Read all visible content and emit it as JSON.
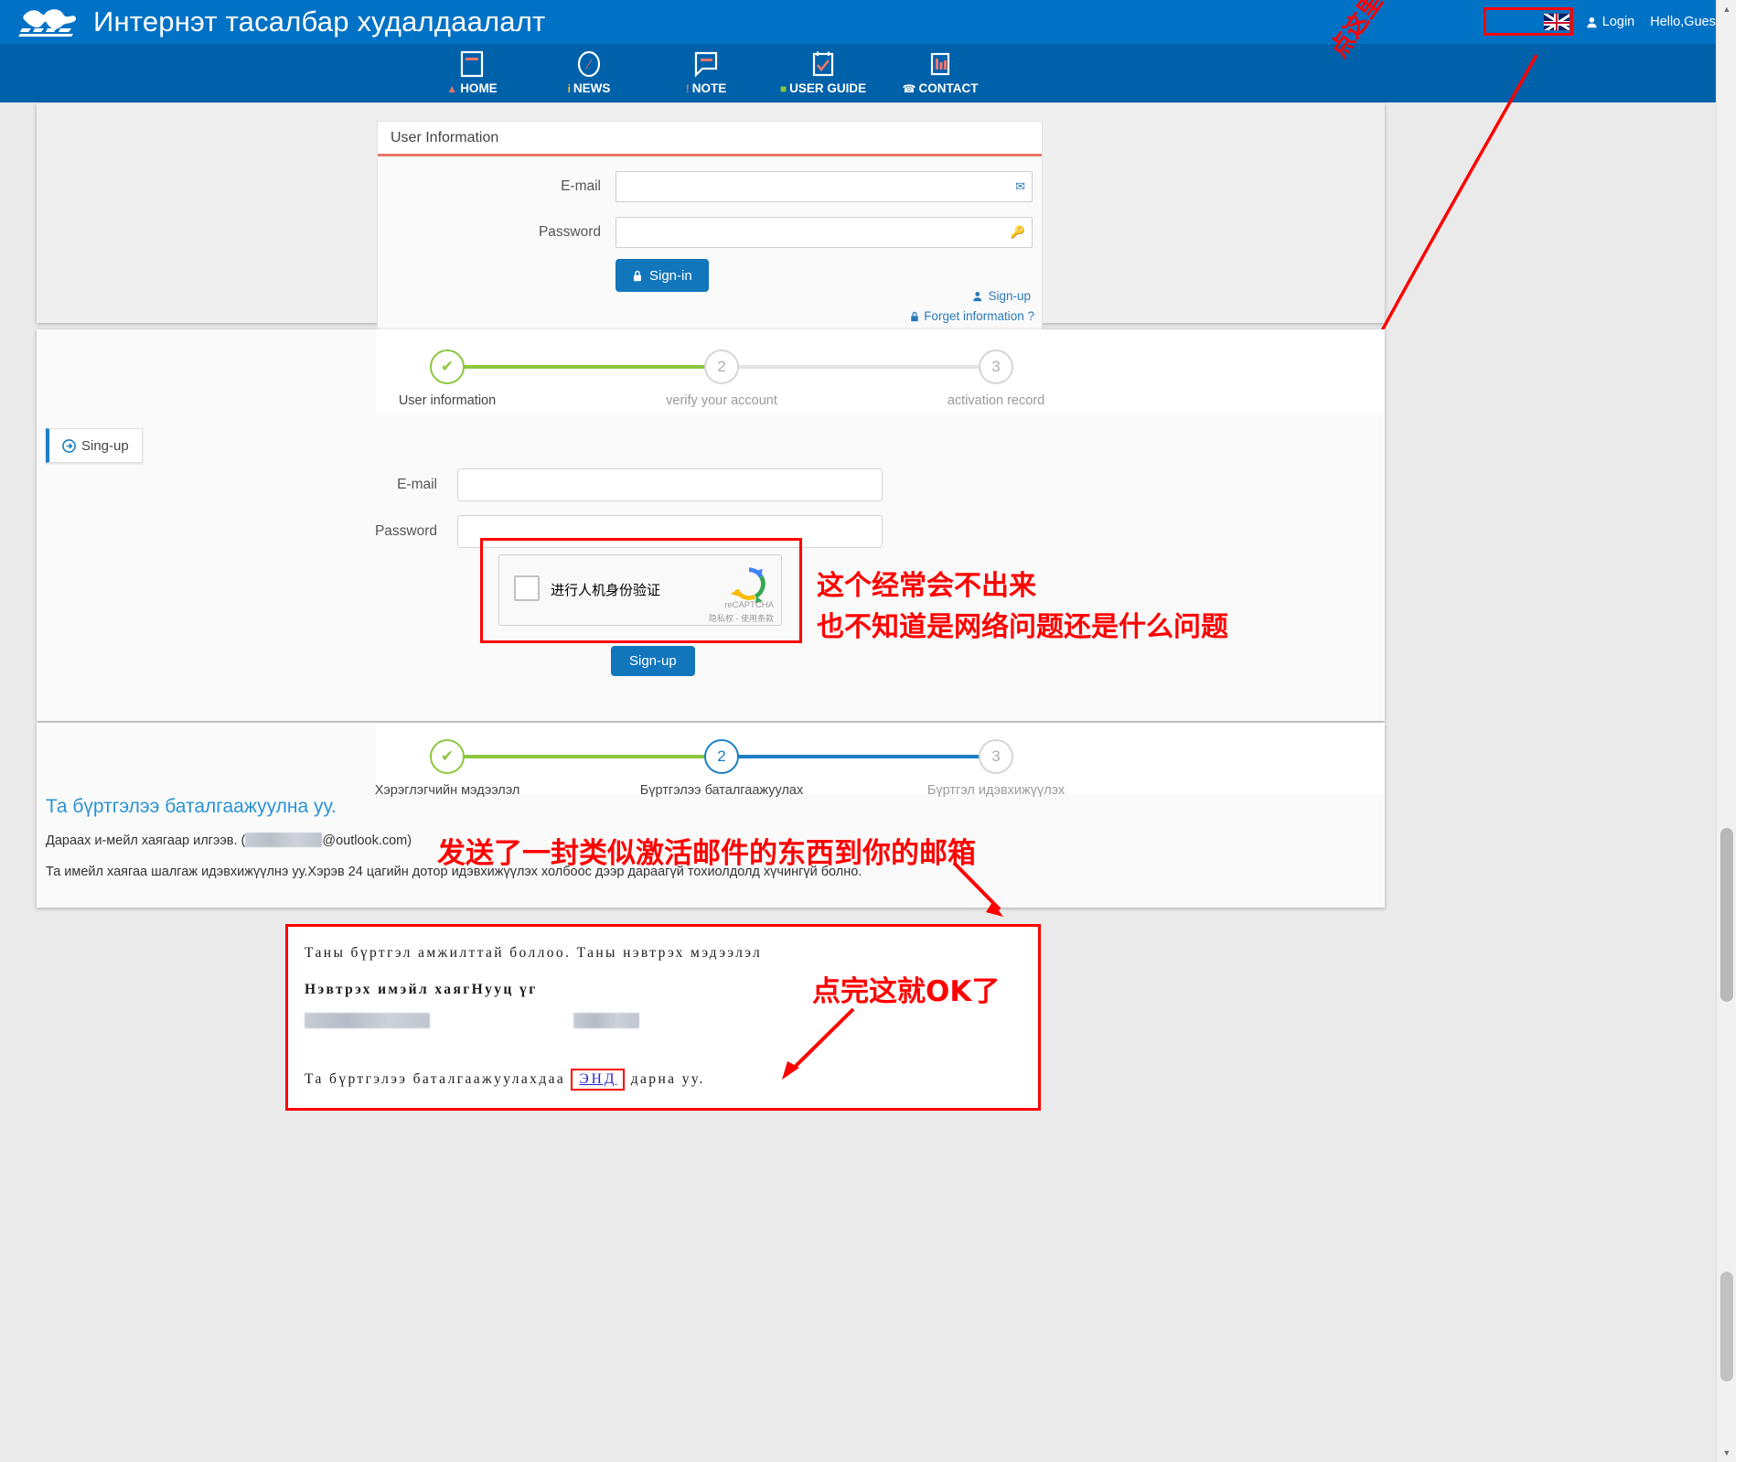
{
  "header": {
    "title": "Интернэт тасалбар худалдаалалт",
    "logo_alt": "railway-horses-logo",
    "flag": "uk-flag-icon",
    "login_label": "Login",
    "login_icon": "user-icon",
    "greeting": "Hello,Guest"
  },
  "nav": {
    "items": [
      {
        "label": "HOME",
        "icon": "home-icon",
        "glyph": "🏠",
        "glyph_color": "#e8776a"
      },
      {
        "label": "NEWS",
        "icon": "compass-icon",
        "glyph": "i",
        "glyph_color": "#f5c518"
      },
      {
        "label": "NOTE",
        "icon": "note-icon",
        "glyph": "!",
        "glyph_color": "#e8776a"
      },
      {
        "label": "USER GUIDE",
        "icon": "guide-icon",
        "glyph": "☰",
        "glyph_color": "#8CC63E"
      },
      {
        "label": "CONTACT",
        "icon": "contact-icon",
        "glyph": "✆",
        "glyph_color": "#ffffff"
      }
    ]
  },
  "login_panel": {
    "heading": "User Information",
    "email_label": "E-mail",
    "email_value": "",
    "email_icon": "envelope-icon",
    "password_label": "Password",
    "password_value": "",
    "password_icon": "key-icon",
    "signin_label": "Sign-in",
    "signin_icon": "lock-icon",
    "signup_label": "Sign-up",
    "signup_icon": "user-add-icon",
    "forget_label": "Forget information ?",
    "forget_icon": "lock-icon"
  },
  "signup_section": {
    "tab_label": "Sing-up",
    "tab_icon": "arrow-circle-icon",
    "steps": [
      {
        "marker": "✔",
        "label": "User information",
        "state": "done"
      },
      {
        "marker": "2",
        "label": "verify your account",
        "state": "pending"
      },
      {
        "marker": "3",
        "label": "activation record",
        "state": "pending"
      }
    ],
    "email_label": "E-mail",
    "email_value": "",
    "password_label": "Password",
    "password_value": "",
    "recaptcha": {
      "checkbox_label": "进行人机身份验证",
      "brand": "reCAPTCHA",
      "legal": "隐私权 - 使用条款",
      "logo_icon": "recaptcha-logo-icon"
    },
    "submit_label": "Sign-up"
  },
  "verify_section": {
    "steps": [
      {
        "marker": "✔",
        "label": "Хэрэглэгчийн мэдээлэл",
        "state": "done"
      },
      {
        "marker": "2",
        "label": "Бүртгэлээ баталгаажуулах",
        "state": "active"
      },
      {
        "marker": "3",
        "label": "Бүртгэл идэвхижүүлэх",
        "state": "pending"
      }
    ],
    "title": "Та бүртгэлээ баталгаажуулна уу.",
    "line1_prefix": "Дараах и-мейл хаягаар илгээв. (",
    "line1_masked_domain": "@outlook.com",
    "line1_suffix": ")",
    "line2": "Та имейл хаягаа шалгаж идэвхижүүлнэ уу.Хэрэв 24 цагийн дотор идэвхижүүлэх холбоос дээр дараагүй тохиолдолд хүчингүй болно."
  },
  "email_box": {
    "line1": "Таны бүртгэл амжилттай боллоо. Таны нэвтрэх мэдээлэл",
    "line2": "Нэвтрэх имэйл хаягНууц үг",
    "line3_prefix": "Та бүртгэлээ баталгаажуулахдаа",
    "link_label": "ЭНД",
    "line3_suffix": "дарна уу."
  },
  "annotations": {
    "login_callout": "点这里注册",
    "captcha_line1": "这个经常会不出来",
    "captcha_line2": "也不知道是网络问题还是什么问题",
    "email_note": "发送了一封类似激活邮件的东西到你的邮箱",
    "ok_note": "点完这就OK了",
    "color": "#ff0000"
  },
  "scrollbar": {
    "up_arrow": "▲",
    "down_arrow": "▼"
  }
}
